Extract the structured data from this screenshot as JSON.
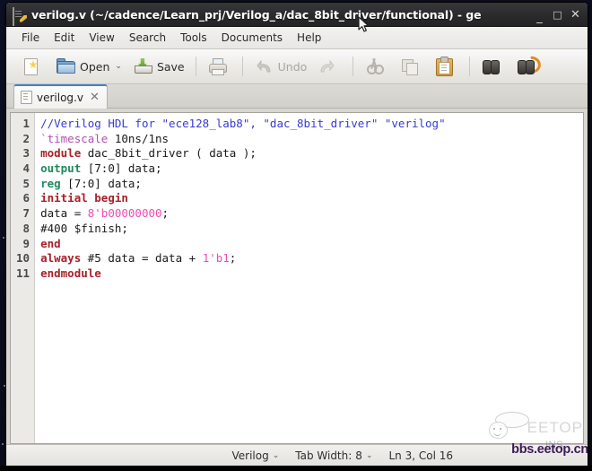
{
  "window": {
    "title": "verilog.v (~/cadence/Learn_prj/Verilog_a/dac_8bit_driver/functional) - ge",
    "icon": "document-pencil-icon",
    "controls": {
      "minimize": "_",
      "maximize": "□",
      "close": "✕"
    }
  },
  "menubar": {
    "items": [
      {
        "label": "File"
      },
      {
        "label": "Edit"
      },
      {
        "label": "View"
      },
      {
        "label": "Search"
      },
      {
        "label": "Tools"
      },
      {
        "label": "Documents"
      },
      {
        "label": "Help"
      }
    ]
  },
  "toolbar": {
    "new_label": "",
    "open_label": "Open",
    "open_caret": "⌄",
    "save_label": "Save",
    "print_label": "",
    "undo_label": "Undo",
    "redo_label": "",
    "cut_label": "",
    "copy_label": "",
    "paste_label": "",
    "find_label": "",
    "replace_label": "",
    "icons": {
      "new": "new-document-icon",
      "open": "open-folder-icon",
      "save": "save-icon",
      "print": "print-icon",
      "undo": "undo-arrow-icon",
      "redo": "redo-arrow-icon",
      "cut": "scissors-icon",
      "copy": "copy-icon",
      "paste": "clipboard-paste-icon",
      "find": "binoculars-icon",
      "replace": "find-replace-icon"
    }
  },
  "tabs": [
    {
      "label": "verilog.v",
      "close": "✕",
      "active": true
    }
  ],
  "editor": {
    "line_numbers": [
      "1",
      "2",
      "3",
      "4",
      "5",
      "6",
      "7",
      "8",
      "9",
      "10",
      "11"
    ],
    "lines": [
      {
        "n": 1,
        "tokens": [
          {
            "t": "//Verilog HDL for \"ece128_lab8\", \"dac_8bit_driver\" \"verilog\"",
            "c": "comment"
          }
        ]
      },
      {
        "n": 2,
        "tokens": [
          {
            "t": "`timescale",
            "c": "directive"
          },
          {
            "t": " 10ns/1ns",
            "c": "plain"
          }
        ]
      },
      {
        "n": 3,
        "tokens": [
          {
            "t": "module",
            "c": "keyword"
          },
          {
            "t": " dac_8bit_driver ( data );",
            "c": "plain"
          }
        ]
      },
      {
        "n": 4,
        "tokens": [
          {
            "t": "output",
            "c": "type"
          },
          {
            "t": " [7:0] data;",
            "c": "plain"
          }
        ]
      },
      {
        "n": 5,
        "tokens": [
          {
            "t": "reg",
            "c": "type"
          },
          {
            "t": " [7:0] data;",
            "c": "plain"
          }
        ]
      },
      {
        "n": 6,
        "tokens": [
          {
            "t": "initial begin",
            "c": "keyword"
          }
        ]
      },
      {
        "n": 7,
        "tokens": [
          {
            "t": "data = ",
            "c": "plain"
          },
          {
            "t": "8'b00000000",
            "c": "number"
          },
          {
            "t": ";",
            "c": "plain"
          }
        ]
      },
      {
        "n": 8,
        "tokens": [
          {
            "t": "#400 $finish;",
            "c": "plain"
          }
        ]
      },
      {
        "n": 9,
        "tokens": [
          {
            "t": "end",
            "c": "keyword"
          }
        ]
      },
      {
        "n": 10,
        "tokens": [
          {
            "t": "always",
            "c": "keyword"
          },
          {
            "t": " #5 data = data + ",
            "c": "plain"
          },
          {
            "t": "1'b1",
            "c": "number"
          },
          {
            "t": ";",
            "c": "plain"
          }
        ]
      },
      {
        "n": 11,
        "tokens": [
          {
            "t": "endmodule",
            "c": "keyword"
          }
        ]
      }
    ]
  },
  "statusbar": {
    "language": "Verilog",
    "language_caret": "⌄",
    "tab_width_label": "Tab Width:",
    "tab_width_value": "8",
    "tab_width_caret": "⌄",
    "cursor_position": "Ln 3, Col 16"
  },
  "watermark": {
    "brand": "EETOP",
    "ins": "INS",
    "site": "bbs.eetop.cn"
  },
  "colors": {
    "titlebar": "#2a2a2c",
    "tab_accent": "#4a7fc1",
    "comment": "#3a3ad0",
    "directive": "#b24fb2",
    "keyword": "#a8202a",
    "type": "#1f8a5c",
    "number": "#ef4bb4",
    "watermark_site": "#3d1a57"
  }
}
